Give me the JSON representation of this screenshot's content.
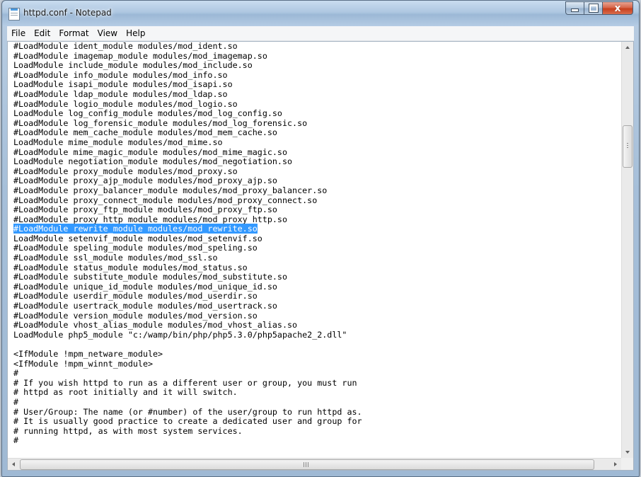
{
  "window": {
    "title": "httpd.conf - Notepad",
    "close_glyph": "x"
  },
  "menu": [
    "File",
    "Edit",
    "Format",
    "View",
    "Help"
  ],
  "lines": [
    "#LoadModule ident_module modules/mod_ident.so",
    "#LoadModule imagemap_module modules/mod_imagemap.so",
    "LoadModule include_module modules/mod_include.so",
    "#LoadModule info_module modules/mod_info.so",
    "LoadModule isapi_module modules/mod_isapi.so",
    "#LoadModule ldap_module modules/mod_ldap.so",
    "#LoadModule logio_module modules/mod_logio.so",
    "LoadModule log_config_module modules/mod_log_config.so",
    "#LoadModule log_forensic_module modules/mod_log_forensic.so",
    "#LoadModule mem_cache_module modules/mod_mem_cache.so",
    "LoadModule mime_module modules/mod_mime.so",
    "#LoadModule mime_magic_module modules/mod_mime_magic.so",
    "LoadModule negotiation_module modules/mod_negotiation.so",
    "#LoadModule proxy_module modules/mod_proxy.so",
    "#LoadModule proxy_ajp_module modules/mod_proxy_ajp.so",
    "#LoadModule proxy_balancer_module modules/mod_proxy_balancer.so",
    "#LoadModule proxy_connect_module modules/mod_proxy_connect.so",
    "#LoadModule proxy_ftp_module modules/mod_proxy_ftp.so",
    "#LoadModule proxy_http_module modules/mod_proxy_http.so",
    "#LoadModule rewrite_module modules/mod_rewrite.so",
    "LoadModule setenvif_module modules/mod_setenvif.so",
    "#LoadModule speling_module modules/mod_speling.so",
    "#LoadModule ssl_module modules/mod_ssl.so",
    "#LoadModule status_module modules/mod_status.so",
    "#LoadModule substitute_module modules/mod_substitute.so",
    "#LoadModule unique_id_module modules/mod_unique_id.so",
    "#LoadModule userdir_module modules/mod_userdir.so",
    "#LoadModule usertrack_module modules/mod_usertrack.so",
    "#LoadModule version_module modules/mod_version.so",
    "#LoadModule vhost_alias_module modules/mod_vhost_alias.so",
    "LoadModule php5_module \"c:/wamp/bin/php/php5.3.0/php5apache2_2.dll\"",
    "",
    "<IfModule !mpm_netware_module>",
    "<IfModule !mpm_winnt_module>",
    "#",
    "# If you wish httpd to run as a different user or group, you must run",
    "# httpd as root initially and it will switch.",
    "#",
    "# User/Group: The name (or #number) of the user/group to run httpd as.",
    "# It is usually good practice to create a dedicated user and group for",
    "# running httpd, as with most system services.",
    "#"
  ],
  "selected_line_index": 19,
  "hscroll_glyph": "III",
  "colors": {
    "selection": "#3399ff",
    "close_button": "#c7401e"
  },
  "icons": {
    "app": "notepad-icon",
    "minimize": "minimize-icon",
    "maximize": "maximize-icon",
    "close": "close-icon"
  }
}
